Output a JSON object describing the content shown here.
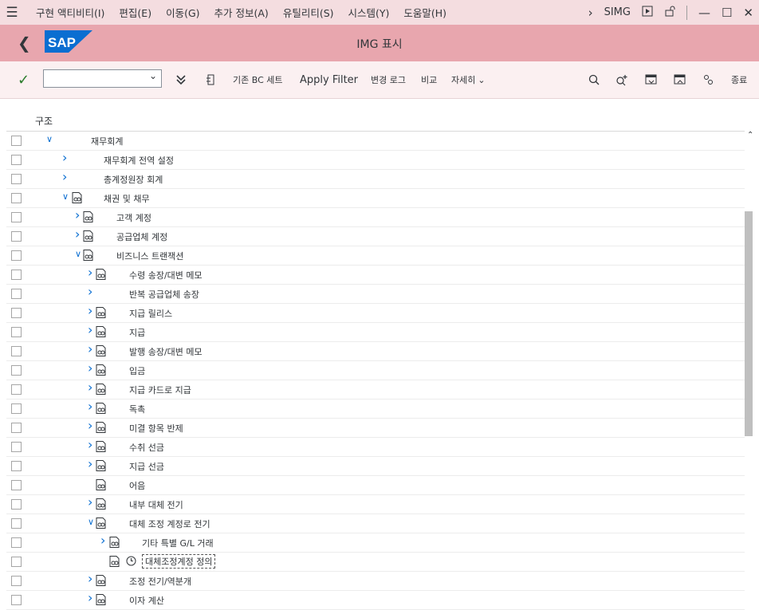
{
  "menu": [
    "구현 액티비티(I)",
    "편집(E)",
    "이동(G)",
    "추가 정보(A)",
    "유틸리티(S)",
    "시스템(Y)",
    "도움말(H)"
  ],
  "menu_right": {
    "transaction": "SIMG"
  },
  "title": {
    "logo": "SAP",
    "text": "IMG  표시"
  },
  "toolbar": {
    "bc_set": "기존 BC 세트",
    "apply_filter": "Apply Filter",
    "change_log": "변경 로그",
    "compare": "비교",
    "more": "자세히",
    "exit": "종료",
    "combo_value": ""
  },
  "tree": {
    "header": "구조",
    "rows": [
      {
        "label": "재무회계",
        "level": 0,
        "expander": "down",
        "doc": false,
        "clock": false
      },
      {
        "label": "재무회계 전역 설정",
        "level": 1,
        "expander": "right",
        "doc": false,
        "clock": false
      },
      {
        "label": "총계정원장 회계",
        "level": 1,
        "expander": "right",
        "doc": false,
        "clock": false
      },
      {
        "label": "채권 및 채무",
        "level": 1,
        "expander": "down",
        "doc": true,
        "clock": false
      },
      {
        "label": "고객 계정",
        "level": 2,
        "expander": "right",
        "doc": true,
        "clock": false
      },
      {
        "label": "공급업체 계정",
        "level": 2,
        "expander": "right",
        "doc": true,
        "clock": false
      },
      {
        "label": "비즈니스 트랜잭션",
        "level": 2,
        "expander": "down",
        "doc": true,
        "clock": false
      },
      {
        "label": "수령 송장/대변 메모",
        "level": 3,
        "expander": "right",
        "doc": true,
        "clock": false
      },
      {
        "label": "반복 공급업체 송장",
        "level": 3,
        "expander": "right",
        "doc": false,
        "clock": false
      },
      {
        "label": "지급 릴리스",
        "level": 3,
        "expander": "right",
        "doc": true,
        "clock": false
      },
      {
        "label": "지급",
        "level": 3,
        "expander": "right",
        "doc": true,
        "clock": false
      },
      {
        "label": "발행 송장/대변 메모",
        "level": 3,
        "expander": "right",
        "doc": true,
        "clock": false
      },
      {
        "label": "입금",
        "level": 3,
        "expander": "right",
        "doc": true,
        "clock": false
      },
      {
        "label": "지급 카드로 지급",
        "level": 3,
        "expander": "right",
        "doc": true,
        "clock": false
      },
      {
        "label": "독촉",
        "level": 3,
        "expander": "right",
        "doc": true,
        "clock": false
      },
      {
        "label": "미결 항목 반제",
        "level": 3,
        "expander": "right",
        "doc": true,
        "clock": false
      },
      {
        "label": "수취 선금",
        "level": 3,
        "expander": "right",
        "doc": true,
        "clock": false
      },
      {
        "label": "지급 선금",
        "level": 3,
        "expander": "right",
        "doc": true,
        "clock": false
      },
      {
        "label": "어음",
        "level": 3,
        "expander": "none",
        "doc": true,
        "clock": false
      },
      {
        "label": "내부 대체 전기",
        "level": 3,
        "expander": "right",
        "doc": true,
        "clock": false
      },
      {
        "label": "대체 조정 계정로 전기",
        "level": 3,
        "expander": "down",
        "doc": true,
        "clock": false
      },
      {
        "label": "기타 특별 G/L 거래",
        "level": 4,
        "expander": "right",
        "doc": true,
        "clock": false
      },
      {
        "label": "대체조정계정 정의",
        "level": 4,
        "expander": "none",
        "doc": true,
        "clock": true,
        "selected": true
      },
      {
        "label": "조정 전기/역분개",
        "level": 3,
        "expander": "right",
        "doc": true,
        "clock": false
      },
      {
        "label": "이자 계산",
        "level": 3,
        "expander": "right",
        "doc": true,
        "clock": false
      }
    ]
  },
  "colors": {
    "menubar": "#f4dde0",
    "titlebar": "#e8a6ae",
    "toolbar": "#fbf0f1",
    "accent": "#0a6ed1",
    "check": "#2b7c2b",
    "logo": "#0a6ed1"
  }
}
